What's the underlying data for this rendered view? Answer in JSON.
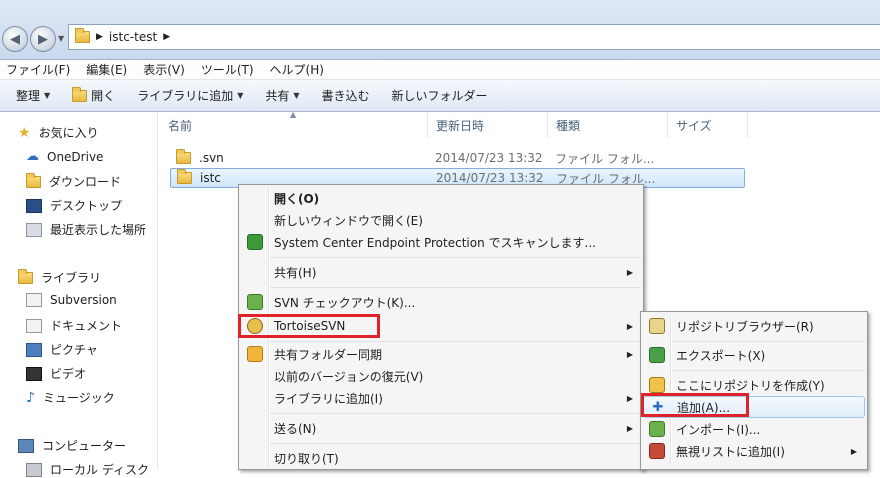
{
  "window": {
    "address": {
      "segment": "istc-test"
    }
  },
  "menubar": {
    "items": [
      "ファイル(F)",
      "編集(E)",
      "表示(V)",
      "ツール(T)",
      "ヘルプ(H)"
    ]
  },
  "toolbar": {
    "organize": "整理",
    "open": "開く",
    "add_to_library": "ライブラリに追加",
    "share": "共有",
    "burn": "書き込む",
    "new_folder": "新しいフォルダー"
  },
  "sidebar": {
    "favorites": "お気に入り",
    "onedrive": "OneDrive",
    "downloads": "ダウンロード",
    "desktop": "デスクトップ",
    "recent": "最近表示した場所",
    "libraries": "ライブラリ",
    "subversion": "Subversion",
    "documents": "ドキュメント",
    "pictures": "ピクチャ",
    "videos": "ビデオ",
    "music": "ミュージック",
    "computer": "コンピューター",
    "local_disk": "ローカル ディスク"
  },
  "columns": {
    "name": "名前",
    "modified": "更新日時",
    "type": "種類",
    "size": "サイズ"
  },
  "files": [
    {
      "name": ".svn",
      "modified": "2014/07/23 13:32",
      "type": "ファイル フォル..."
    },
    {
      "name": "istc",
      "modified": "2014/07/23 13:32",
      "type": "ファイル フォル..."
    }
  ],
  "context_menu": {
    "open": "開く(O)",
    "open_new_window": "新しいウィンドウで開く(E)",
    "scan": "System Center Endpoint Protection でスキャンします...",
    "share": "共有(H)",
    "svn_checkout": "SVN チェックアウト(K)...",
    "tortoisesvn": "TortoiseSVN",
    "sync": "共有フォルダー同期",
    "restore": "以前のバージョンの復元(V)",
    "add_library": "ライブラリに追加(I)",
    "send_to": "送る(N)",
    "cut": "切り取り(T)"
  },
  "submenu": {
    "repo_browser": "リポジトリブラウザー(R)",
    "export": "エクスポート(X)",
    "create_repo": "ここにリポジトリを作成(Y)",
    "add": "追加(A)...",
    "import": "インポート(I)...",
    "ignore": "無視リストに追加(I)"
  },
  "colors": {
    "highlight": "#e0232b",
    "selection": "#cfe6fc"
  }
}
